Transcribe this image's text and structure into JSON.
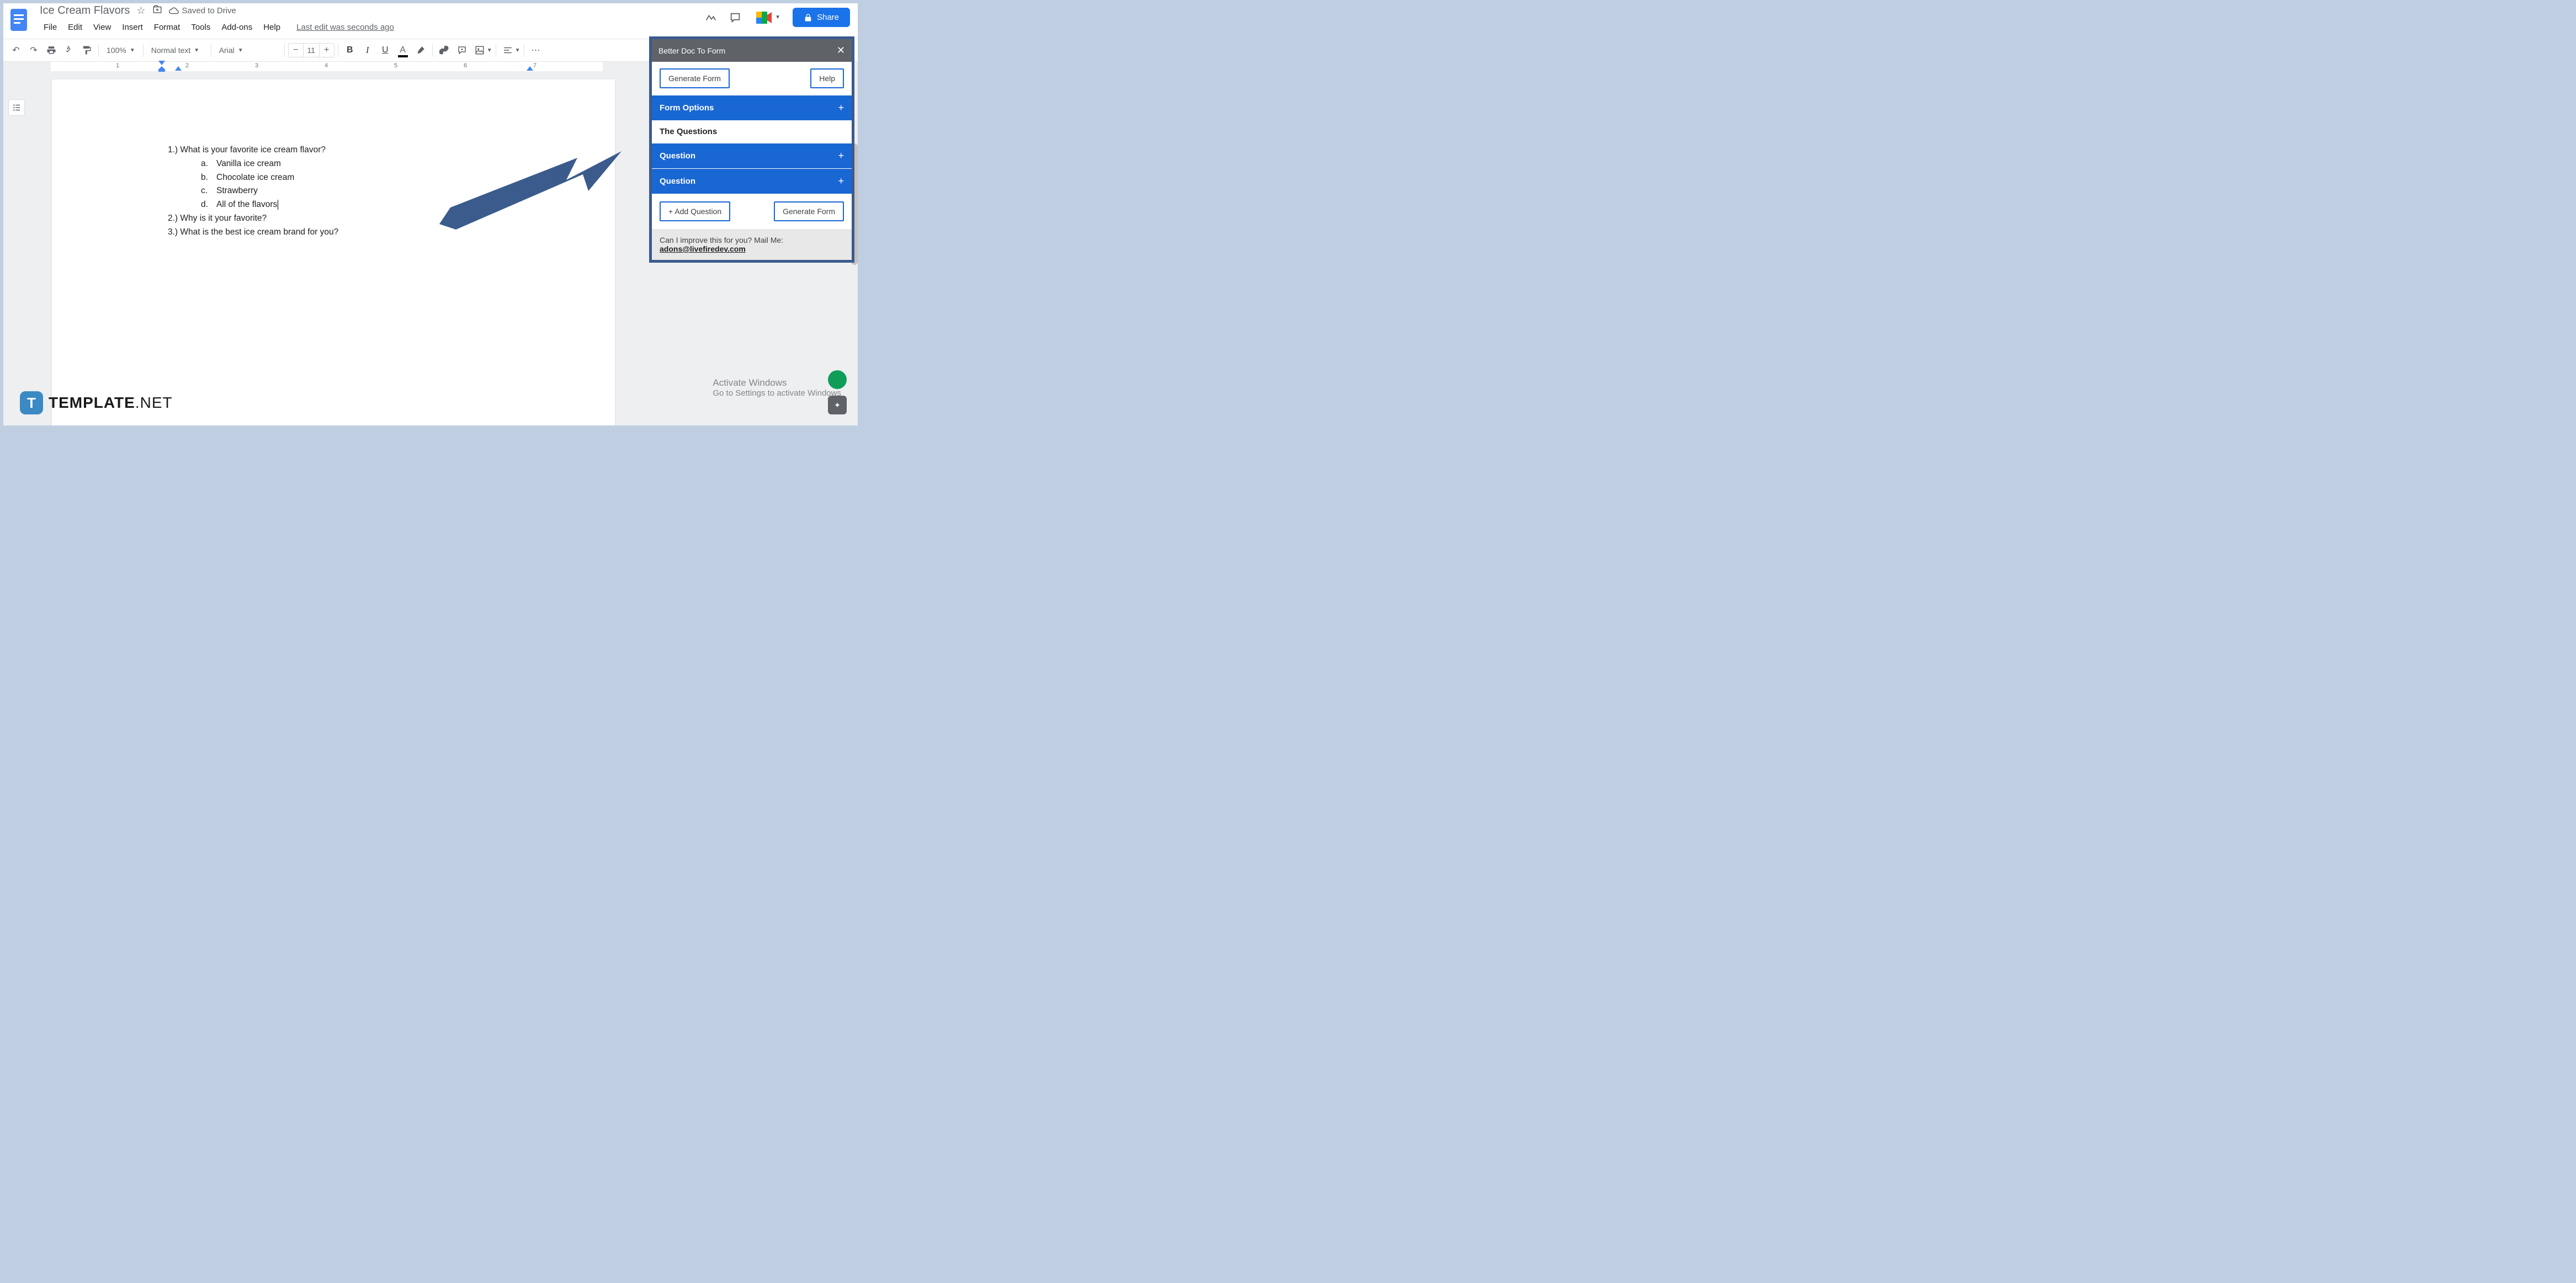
{
  "header": {
    "doc_title": "Ice Cream Flavors",
    "saved_status": "Saved to Drive",
    "last_edit": "Last edit was seconds ago",
    "share_label": "Share",
    "menus": [
      "File",
      "Edit",
      "View",
      "Insert",
      "Format",
      "Tools",
      "Add-ons",
      "Help"
    ]
  },
  "toolbar": {
    "zoom": "100%",
    "style": "Normal text",
    "font": "Arial",
    "font_size": "11",
    "bold": "B",
    "italic": "I",
    "underline": "U",
    "text_color_letter": "A"
  },
  "ruler": {
    "marks": [
      "1",
      "2",
      "3",
      "4",
      "5",
      "6",
      "7"
    ]
  },
  "document": {
    "q1_num": "1.) ",
    "q1_text": "What is your favorite ice cream flavor?",
    "q1_opts": [
      {
        "l": "a.",
        "t": "Vanilla ice cream"
      },
      {
        "l": "b.",
        "t": "Chocolate ice cream"
      },
      {
        "l": "c.",
        "t": "Strawberry"
      },
      {
        "l": "d.",
        "t": "All of the flavors"
      }
    ],
    "q2_num": "2.) ",
    "q2_text": "Why is it your favorite?",
    "q3_num": "3.) ",
    "q3_text": "What is the best ice cream brand for you?"
  },
  "sidebar": {
    "title": "Better Doc To Form",
    "generate_btn": "Generate Form",
    "help_btn": "Help",
    "form_options": "Form Options",
    "the_questions": "The Questions",
    "question": "Question",
    "add_question": "+ Add Question",
    "generate_btn2": "Generate Form",
    "footer_text": "Can I improve this for you? Mail Me:",
    "footer_email": "adons@livefiredev.com"
  },
  "watermark": {
    "title": "Activate Windows",
    "sub": "Go to Settings to activate Windows"
  },
  "logo": {
    "text1": "TEMPLATE",
    "text2": ".NET",
    "badge": "T"
  },
  "colors": {
    "accent_blue": "#1a73e8",
    "panel_blue": "#1967d2",
    "arrow_blue": "#3b5b8c",
    "frame_border": "#bfcfe1"
  }
}
